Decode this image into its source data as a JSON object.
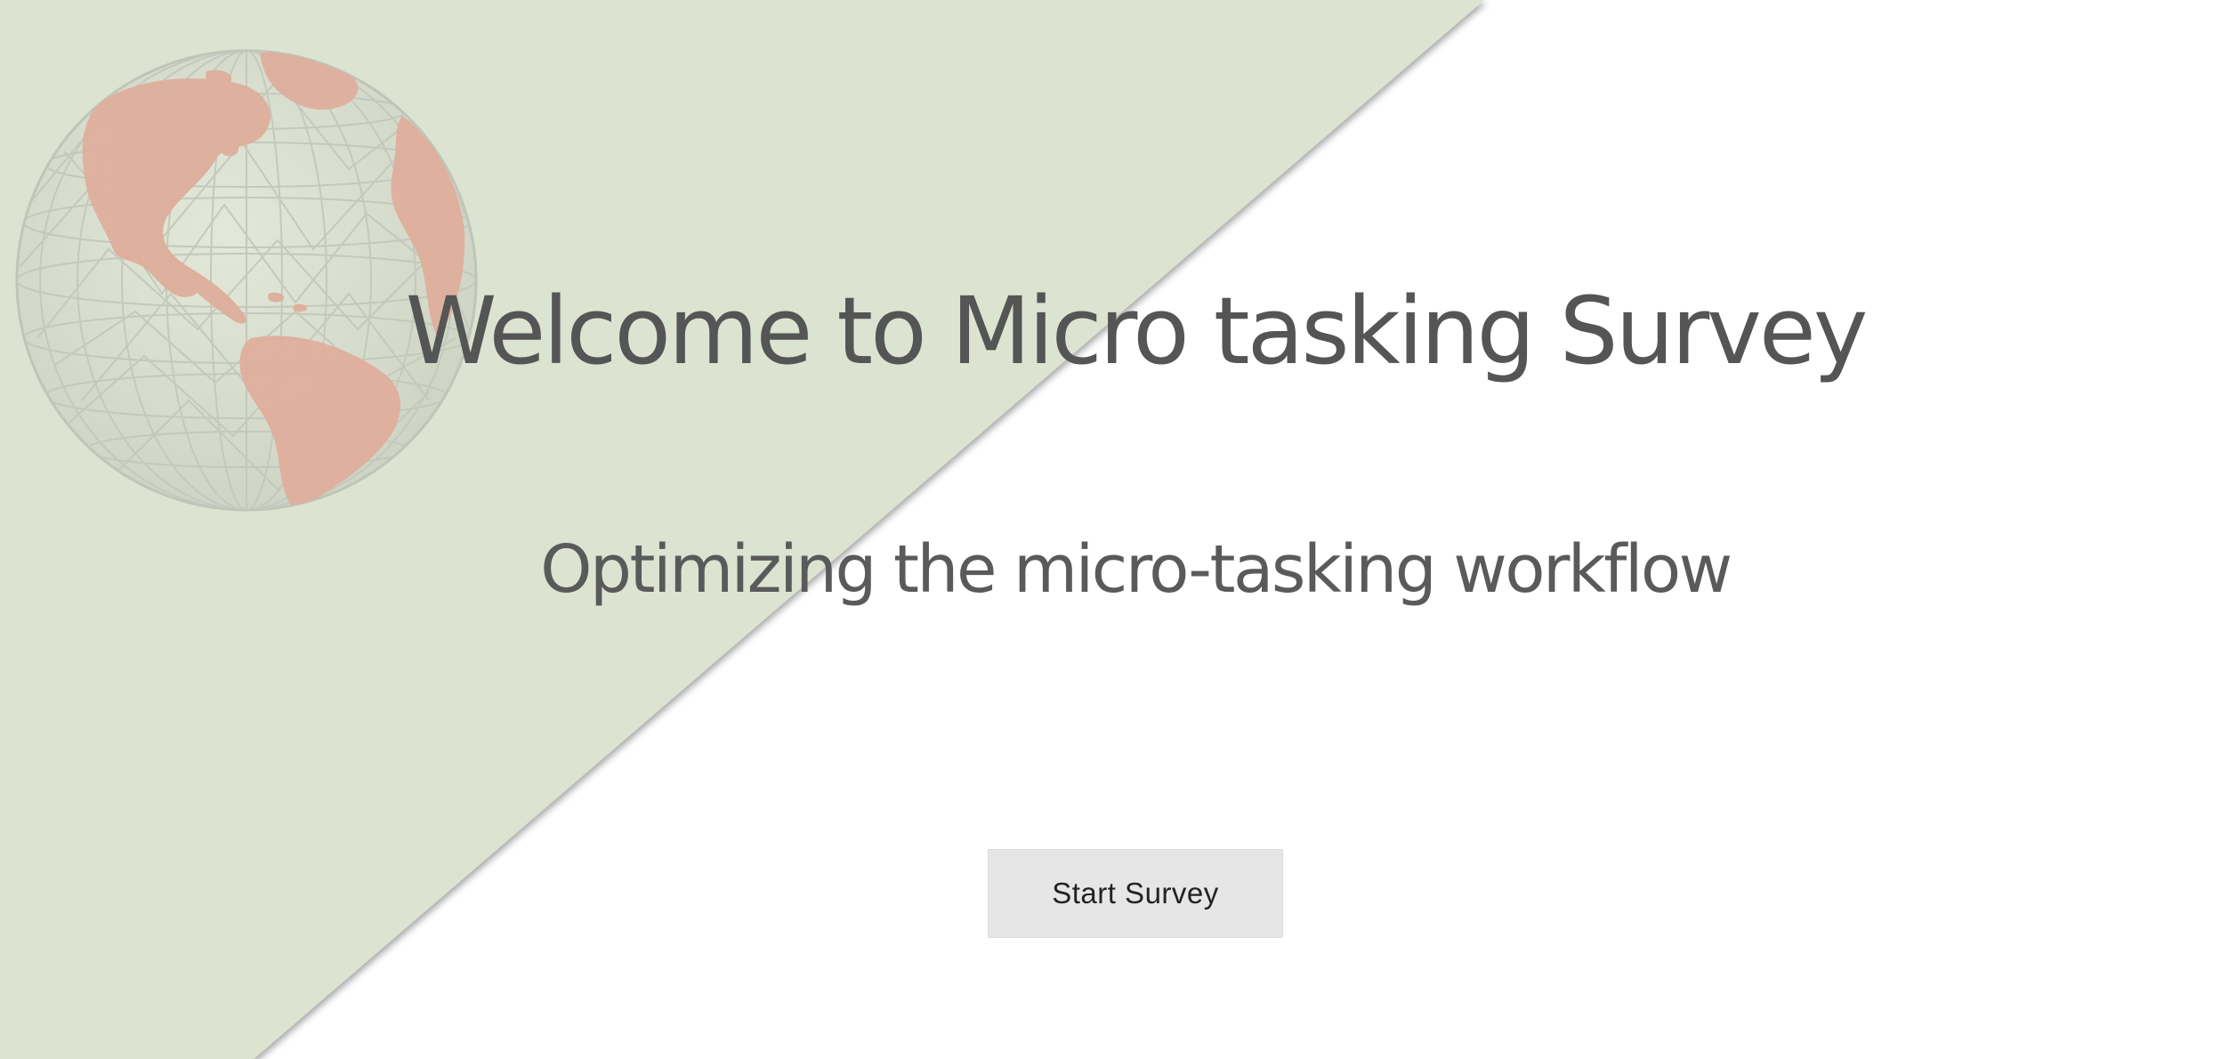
{
  "hero": {
    "title": "Welcome to Micro tasking Survey",
    "subtitle": "Optimizing the micro-tasking workflow",
    "start_button_label": "Start Survey"
  },
  "colors": {
    "background": "#ffffff",
    "diagonal_panel": "#dde3d1",
    "globe_land": "#dfae9c",
    "globe_grid": "#c4c9bd",
    "text": "#555555",
    "button_bg": "#e6e6e6"
  },
  "icons": {
    "decoration": "globe-icon"
  }
}
